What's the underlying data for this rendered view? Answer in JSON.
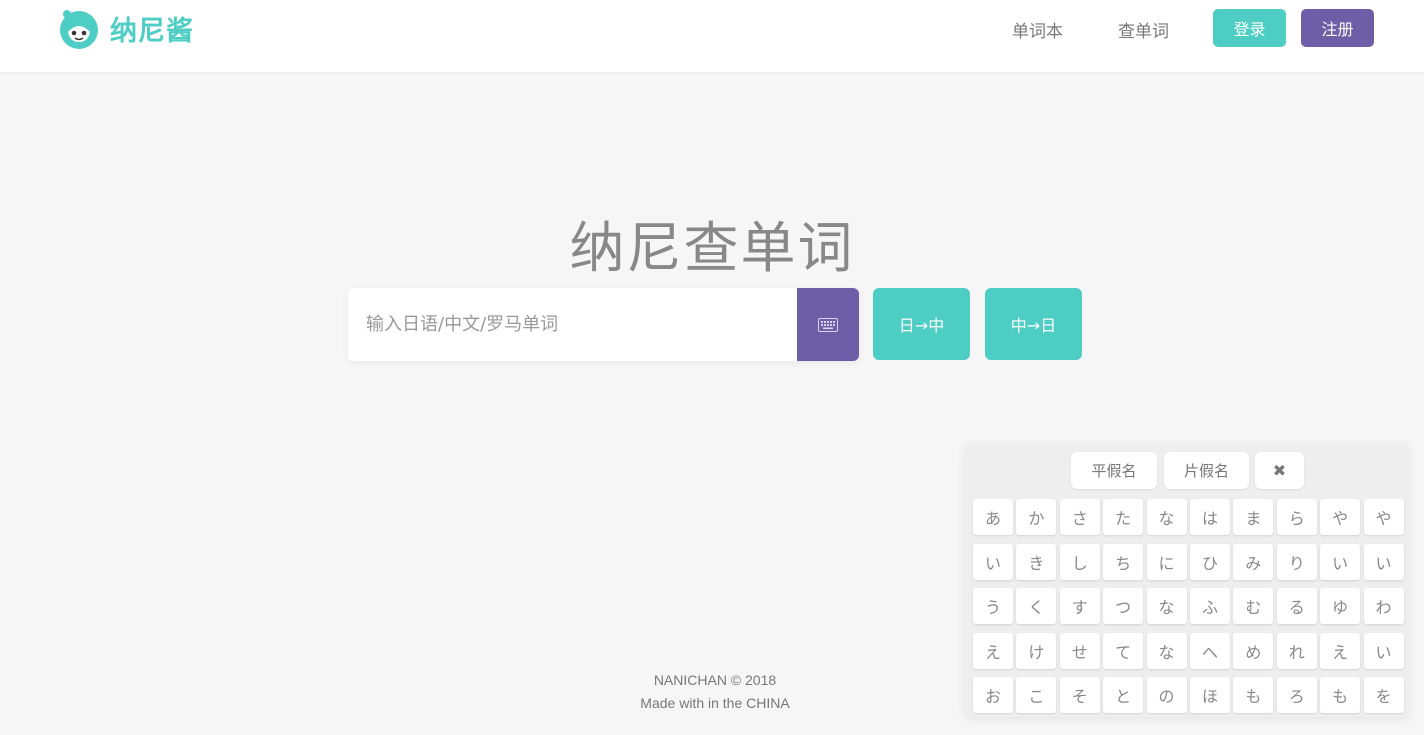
{
  "header": {
    "logo_text": "纳尼酱",
    "nav": [
      {
        "label": "单词本"
      },
      {
        "label": "查单词"
      }
    ],
    "login_label": "登录",
    "register_label": "注册"
  },
  "main": {
    "title": "纳尼查单词",
    "search": {
      "placeholder": "输入日语/中文/罗马单词",
      "value": ""
    },
    "dir_jp_cn": "日→中",
    "dir_cn_jp": "中→日"
  },
  "footer": {
    "line1": "NANICHAN © 2018",
    "line2": "Made with in the CHINA"
  },
  "keyboard": {
    "tab_hiragana": "平假名",
    "tab_katakana": "片假名",
    "close_symbol": "✖",
    "keys": [
      "あ",
      "か",
      "さ",
      "た",
      "な",
      "は",
      "ま",
      "ら",
      "や",
      "や",
      "い",
      "き",
      "し",
      "ち",
      "に",
      "ひ",
      "み",
      "り",
      "い",
      "い",
      "う",
      "く",
      "す",
      "つ",
      "な",
      "ふ",
      "む",
      "る",
      "ゆ",
      "わ",
      "え",
      "け",
      "せ",
      "て",
      "な",
      "へ",
      "め",
      "れ",
      "え",
      "い",
      "お",
      "こ",
      "そ",
      "と",
      "の",
      "ほ",
      "も",
      "ろ",
      "も",
      "を"
    ]
  },
  "colors": {
    "teal": "#4ecdc4",
    "purple": "#6c5fa8"
  }
}
